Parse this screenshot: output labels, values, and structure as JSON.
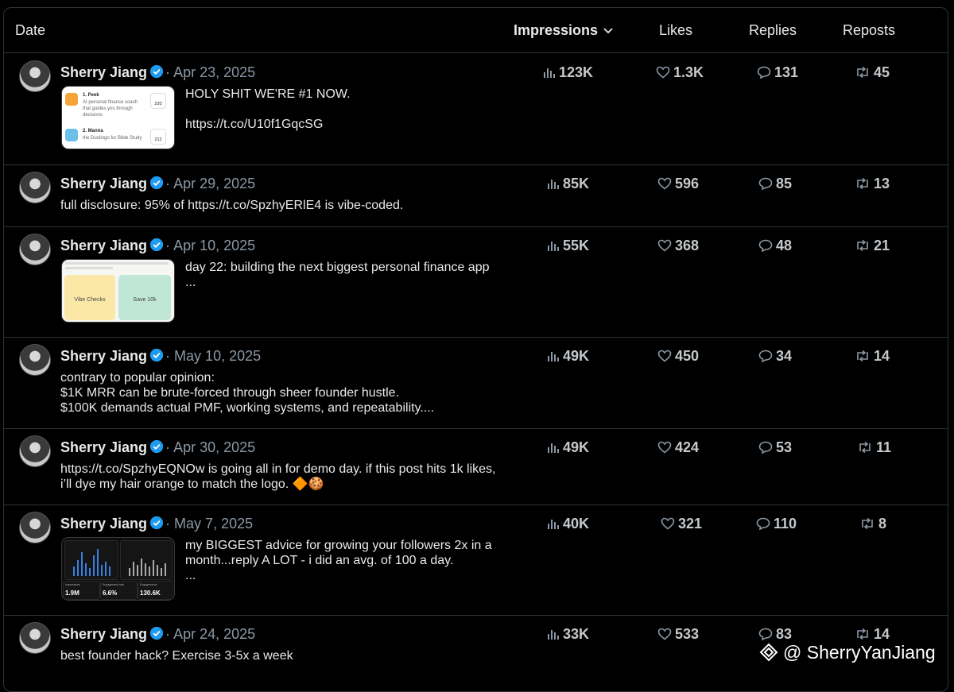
{
  "header": {
    "date": "Date",
    "impressions": "Impressions",
    "likes": "Likes",
    "replies": "Replies",
    "reposts": "Reposts"
  },
  "posts": [
    {
      "author": "Sherry Jiang",
      "date": "Apr 23, 2025",
      "text": "HOLY SHIT WE'RE #1 NOW.\n\nhttps://t.co/U10f1GqcSG",
      "impressions": "123K",
      "likes": "1.3K",
      "replies": "131",
      "reposts": "45",
      "thumb": {
        "items": [
          {
            "rank": "1. Peek",
            "desc": "AI personal finance coach that guides you through decisions",
            "count": "220"
          },
          {
            "rank": "2. Manna",
            "desc": "the Duolingo for Bible Study",
            "count": "212"
          }
        ]
      }
    },
    {
      "author": "Sherry Jiang",
      "date": "Apr 29, 2025",
      "text": "full disclosure: 95% of https://t.co/SpzhyERlE4 is vibe-coded.",
      "impressions": "85K",
      "likes": "596",
      "replies": "85",
      "reposts": "13"
    },
    {
      "author": "Sherry Jiang",
      "date": "Apr 10, 2025",
      "text": "day 22: building the next biggest personal finance app\n...",
      "impressions": "55K",
      "likes": "368",
      "replies": "48",
      "reposts": "21",
      "thumb": {
        "card_left": "Vibe Checks",
        "card_right": "Save 10k"
      }
    },
    {
      "author": "Sherry Jiang",
      "date": "May 10, 2025",
      "text": "contrary to popular opinion:\n$1K MRR can be brute-forced through sheer founder hustle.\n$100K demands actual PMF, working systems, and repeatability....",
      "impressions": "49K",
      "likes": "450",
      "replies": "34",
      "reposts": "14"
    },
    {
      "author": "Sherry Jiang",
      "date": "Apr 30, 2025",
      "text": "https://t.co/SpzhyEQNOw is going all in for demo day. if this post hits 1k likes, i’ll dye my hair orange to match the logo. 🔶🍪",
      "impressions": "49K",
      "likes": "424",
      "replies": "53",
      "reposts": "11"
    },
    {
      "author": "Sherry Jiang",
      "date": "May 7, 2025",
      "text": "my BIGGEST advice for growing your followers 2x in a month...reply A LOT - i did an avg. of 100 a day.\n...",
      "impressions": "40K",
      "likes": "321",
      "replies": "110",
      "reposts": "8",
      "thumb": {
        "stats": [
          {
            "label": "Impressions",
            "value": "1.9M"
          },
          {
            "label": "Engagement rate",
            "value": "6.6%"
          },
          {
            "label": "Engagements",
            "value": "130.6K"
          }
        ]
      }
    },
    {
      "author": "Sherry Jiang",
      "date": "Apr 24, 2025",
      "text": "best founder hack? Exercise 3-5x a week",
      "impressions": "33K",
      "likes": "533",
      "replies": "83",
      "reposts": "14"
    }
  ],
  "watermark": "@ SherryYanJiang"
}
